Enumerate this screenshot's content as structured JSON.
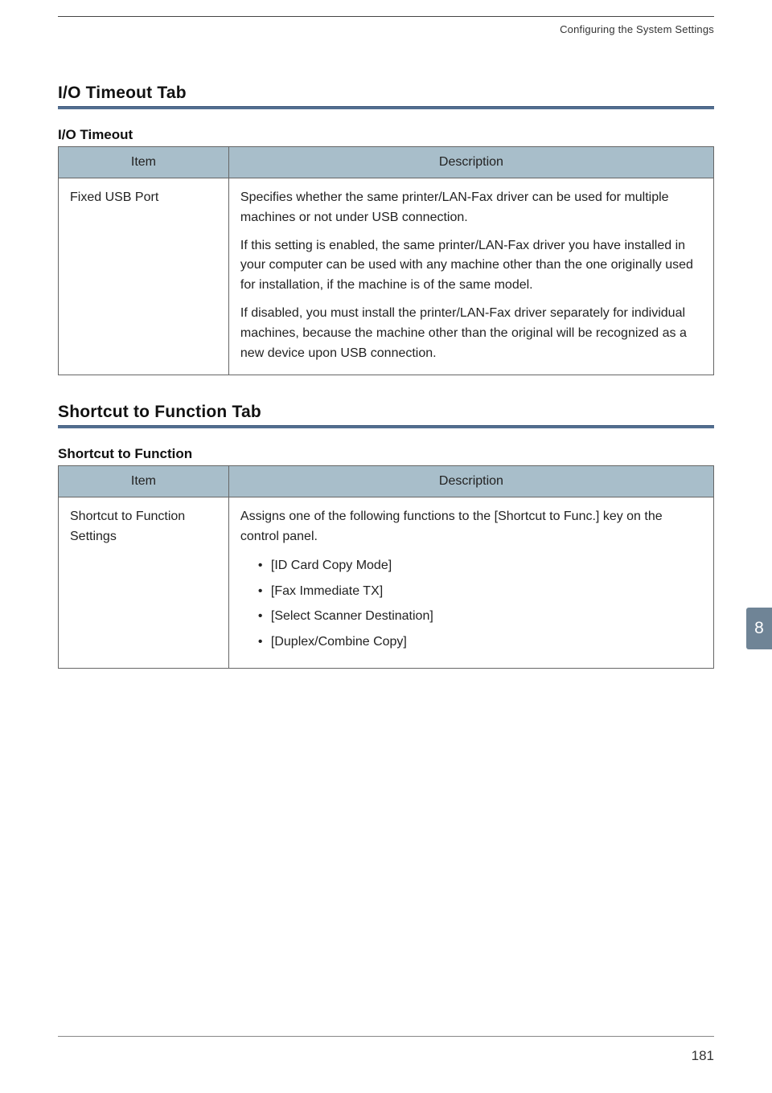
{
  "header": {
    "running_title": "Configuring the System Settings"
  },
  "sections": [
    {
      "title": "I/O Timeout Tab",
      "subheading": "I/O Timeout",
      "table": {
        "headers": {
          "item": "Item",
          "desc": "Description"
        },
        "row": {
          "item": "Fixed USB Port",
          "paragraphs": [
            "Specifies whether the same printer/LAN-Fax driver can be used for multiple machines or not under USB connection.",
            "If this setting is enabled, the same printer/LAN-Fax driver you have installed in your computer can be used with any machine other than the one originally used for installation, if the machine is of the same model.",
            "If disabled, you must install the printer/LAN-Fax driver separately for individual machines, because the machine other than the original will be recognized as a new device upon USB connection."
          ]
        }
      }
    },
    {
      "title": "Shortcut to Function Tab",
      "subheading": "Shortcut to Function",
      "table": {
        "headers": {
          "item": "Item",
          "desc": "Description"
        },
        "row": {
          "item": "Shortcut to Function Settings",
          "intro": "Assigns one of the following functions to the [Shortcut to Func.] key on the control panel.",
          "bullets": [
            "[ID Card Copy Mode]",
            "[Fax Immediate TX]",
            "[Select Scanner Destination]",
            "[Duplex/Combine Copy]"
          ]
        }
      }
    }
  ],
  "side_tab": "8",
  "page_number": "181"
}
